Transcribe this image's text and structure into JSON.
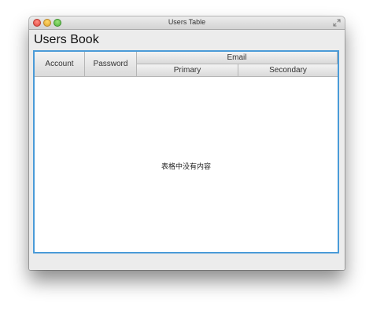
{
  "window": {
    "title": "Users Table"
  },
  "heading": "Users Book",
  "table": {
    "columns": {
      "account": "Account",
      "password": "Password",
      "email": "Email",
      "primary": "Primary",
      "secondary": "Secondary"
    },
    "rows": [],
    "placeholder": "表格中没有内容"
  },
  "colors": {
    "focus_border": "#4a9bd8",
    "window_bg": "#ececec"
  },
  "icons": {
    "close": "close-button-icon",
    "minimize": "minimize-button-icon",
    "maximize": "zoom-button-icon",
    "fullscreen": "fullscreen-arrows-icon"
  }
}
